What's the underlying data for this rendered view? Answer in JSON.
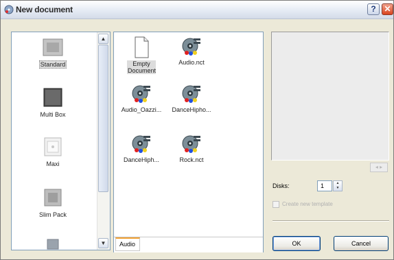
{
  "window": {
    "title": "New document",
    "help_label": "?",
    "close_label": "✕"
  },
  "categories": {
    "items": [
      {
        "label": "Standard",
        "selected": true,
        "icon": "standard-case-icon"
      },
      {
        "label": "Multi Box",
        "selected": false,
        "icon": "multi-box-icon"
      },
      {
        "label": "Maxi",
        "selected": false,
        "icon": "maxi-case-icon"
      },
      {
        "label": "Slim Pack",
        "selected": false,
        "icon": "slim-pack-icon"
      }
    ],
    "scroll_up": "▲",
    "scroll_down": "▼"
  },
  "templates": {
    "items": [
      {
        "label": "Empty Document",
        "selected": true,
        "icon": "empty-document-icon"
      },
      {
        "label": "Audio.nct",
        "selected": false,
        "icon": "audio-disc-icon"
      },
      {
        "label": "Audio_Oazzi...",
        "selected": false,
        "icon": "audio-disc-icon"
      },
      {
        "label": "DanceHipho...",
        "selected": false,
        "icon": "audio-disc-icon"
      },
      {
        "label": "DanceHiph...",
        "selected": false,
        "icon": "audio-disc-icon"
      },
      {
        "label": "Rock.nct",
        "selected": false,
        "icon": "audio-disc-icon"
      }
    ],
    "tab": "Audio"
  },
  "preview": {
    "nav_label": "◂ ▸"
  },
  "disks": {
    "label": "Disks:",
    "value": "1",
    "spin_up": "▲",
    "spin_down": "▼"
  },
  "create_template": {
    "label": "Create new template",
    "checked": false,
    "enabled": false
  },
  "buttons": {
    "ok": "OK",
    "cancel": "Cancel"
  },
  "colors": {
    "title_gradient_start": "#ffffff",
    "selection_gray": "#dcdcdc",
    "tab_accent": "#f0a030",
    "close_red": "#d9421c"
  }
}
